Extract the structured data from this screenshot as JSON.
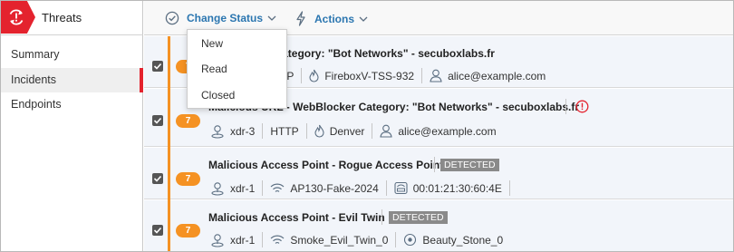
{
  "nav": {
    "title": "Threats",
    "items": [
      {
        "label": "Summary",
        "active": false
      },
      {
        "label": "Incidents",
        "active": true
      },
      {
        "label": "Endpoints",
        "active": false
      }
    ]
  },
  "toolbar": {
    "change_status_label": "Change Status",
    "actions_label": "Actions"
  },
  "status_menu": {
    "options": [
      "New",
      "Read",
      "Closed"
    ]
  },
  "colors": {
    "accent": "#2b76b0",
    "brand_red": "#e4232e",
    "severity_orange": "#f59223",
    "alert_red": "#e4232e"
  },
  "incidents": [
    {
      "checked": true,
      "severity": "7",
      "title": "WebBlocker Category: \"Bot Networks\" - secuboxlabs.fr",
      "meta": [
        {
          "icon": "protocol-icon",
          "text": "TP"
        },
        {
          "icon": "firebox-icon",
          "text": "FireboxV-TSS-932"
        },
        {
          "icon": "user-icon",
          "text": "alice@example.com"
        }
      ]
    },
    {
      "checked": true,
      "severity": "7",
      "title": "Malicious URL - WebBlocker Category: \"Bot Networks\" - secuboxlabs.fr",
      "alert_icon": "alert-circle-icon",
      "meta": [
        {
          "icon": "xdr-icon",
          "text": "xdr-3"
        },
        {
          "icon": "",
          "text": "HTTP"
        },
        {
          "icon": "firebox-icon",
          "text": "Denver"
        },
        {
          "icon": "user-icon",
          "text": "alice@example.com"
        }
      ]
    },
    {
      "checked": true,
      "severity": "7",
      "title": "Malicious Access Point - Rogue Access Point",
      "tag": "DETECTED",
      "meta": [
        {
          "icon": "xdr-icon",
          "text": "xdr-1"
        },
        {
          "icon": "wifi-icon",
          "text": "AP130-Fake-2024"
        },
        {
          "icon": "access-point-icon",
          "text": "00:01:21:30:60:4E"
        }
      ]
    },
    {
      "checked": true,
      "severity": "7",
      "title": "Malicious Access Point - Evil Twin",
      "tag": "DETECTED",
      "meta": [
        {
          "icon": "xdr-icon",
          "text": "xdr-1"
        },
        {
          "icon": "wifi-icon",
          "text": "Smoke_Evil_Twin_0"
        },
        {
          "icon": "location-icon",
          "text": "Beauty_Stone_0"
        }
      ]
    }
  ]
}
